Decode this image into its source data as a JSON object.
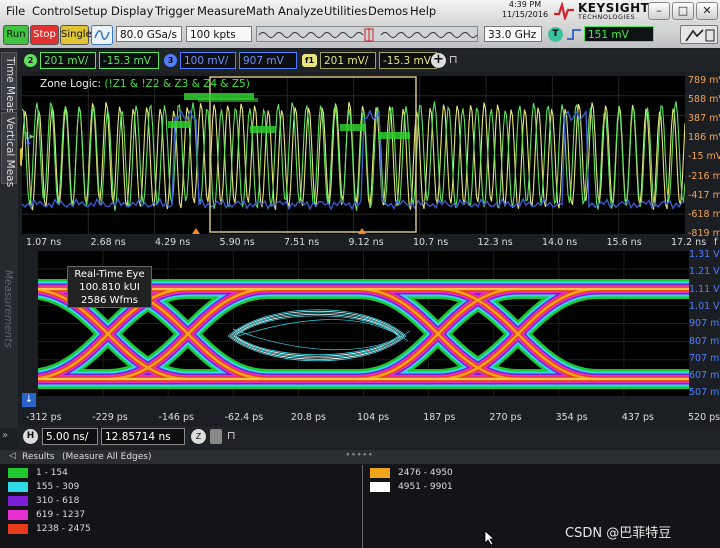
{
  "menu": [
    "File",
    "Control",
    "Setup",
    "Display",
    "Trigger",
    "Measure",
    "Math",
    "Analyze",
    "Utilities",
    "Demos",
    "Help"
  ],
  "clock": {
    "time": "4:39 PM",
    "date": "11/15/2016"
  },
  "brand": {
    "name": "KEYSIGHT",
    "sub": "TECHNOLOGIES"
  },
  "controls": {
    "run": "Run",
    "stop": "Stop",
    "single": "Single",
    "sample_rate": "80.0 GSa/s",
    "memory_depth": "100 kpts",
    "bandwidth": "33.0 GHz",
    "trigger_badge": "T",
    "trigger_level": "151 mV"
  },
  "channels": [
    {
      "badge": "2",
      "scale": "201 mV/",
      "offset": "-15.3 mV",
      "color": "#5ee35e"
    },
    {
      "badge": "3",
      "scale": "100 mV/",
      "offset": "907 mV",
      "color": "#4d7fff"
    },
    {
      "badge": "f1",
      "scale": "201 mV/",
      "offset": "-15.3 mV",
      "color": "#e8e87a"
    }
  ],
  "left_tabs": {
    "time_meas": "Time Meas",
    "vertical_meas": "Vertical Meas",
    "measurements": "Measurements"
  },
  "zone_logic": {
    "label": "Zone Logic:",
    "expr": "(!Z1 & !Z2 & Z3 & Z4 & Z5)"
  },
  "plot1": {
    "y_labels": [
      "789 mV",
      "588 mV",
      "387 mV",
      "186 mV",
      "-15 mV",
      "-216 mV",
      "-417 mV",
      "-618 mV",
      "-819 mV"
    ],
    "x_labels": [
      "1.07 ns",
      "2.68 ns",
      "4.29 ns",
      "5.90 ns",
      "7.51 ns",
      "9.12 ns",
      "10.7 ns",
      "12.3 ns",
      "14.0 ns",
      "15.6 ns",
      "17.2 ns"
    ],
    "x_unit": "f"
  },
  "plot2": {
    "y_labels": [
      "1.31 V",
      "1.21 V",
      "1.11 V",
      "1.01 V",
      "907 mV",
      "807 mV",
      "707 mV",
      "607 mV",
      "507 mV"
    ],
    "x_labels": [
      "-312 ps",
      "-229 ps",
      "-146 ps",
      "-62.4 ps",
      "20.8 ps",
      "104 ps",
      "187 ps",
      "270 ps",
      "354 ps",
      "437 ps",
      "520 ps"
    ],
    "eye_title": "Real-Time Eye",
    "eye_kui": "100.810 kUI",
    "eye_wfms": "2586 Wfms"
  },
  "timebase": {
    "badge": "H",
    "scale": "5.00 ns/",
    "position": "12.85714 ns"
  },
  "results": {
    "title": "Results",
    "subtitle": "(Measure All Edges)",
    "legend": [
      {
        "range": "1 - 154",
        "color": "#1fc82e"
      },
      {
        "range": "155 - 309",
        "color": "#2fd9e8"
      },
      {
        "range": "310 - 618",
        "color": "#7a1fd6"
      },
      {
        "range": "619 - 1237",
        "color": "#e52fd0"
      },
      {
        "range": "1238 - 2475",
        "color": "#e83b1a"
      },
      {
        "range": "2476 - 4950",
        "color": "#f2a51a"
      },
      {
        "range": "4951 - 9901",
        "color": "#ffffff"
      }
    ]
  },
  "watermark": "CSDN @巴菲特豆"
}
